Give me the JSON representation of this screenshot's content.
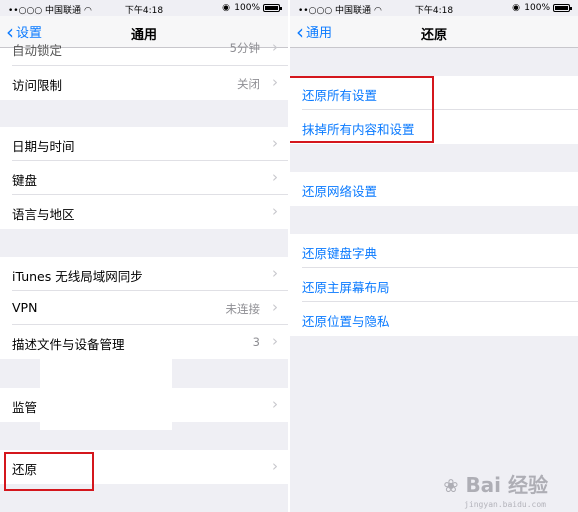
{
  "status": {
    "carrier": "••○○○ 中国联通",
    "time": "下午4:18",
    "battery": "100%"
  },
  "left": {
    "back_label": "设置",
    "title": "通用",
    "rows": {
      "auto_lock": {
        "label": "自动锁定",
        "value": "5分钟"
      },
      "restrictions": {
        "label": "访问限制",
        "value": "关闭"
      },
      "date_time": {
        "label": "日期与时间"
      },
      "keyboard": {
        "label": "键盘"
      },
      "language_region": {
        "label": "语言与地区"
      },
      "itunes_wifi_sync": {
        "label": "iTunes 无线局域网同步"
      },
      "vpn": {
        "label": "VPN",
        "value": "未连接"
      },
      "profiles": {
        "label": "描述文件与设备管理",
        "value": "3"
      },
      "supervision": {
        "label": "监管"
      },
      "reset": {
        "label": "还原"
      }
    }
  },
  "right": {
    "back_label": "通用",
    "title": "还原",
    "rows": {
      "reset_all_settings": {
        "label": "还原所有设置"
      },
      "erase_all": {
        "label": "抹掉所有内容和设置"
      },
      "reset_network": {
        "label": "还原网络设置"
      },
      "reset_keyboard_dictionary": {
        "label": "还原键盘字典"
      },
      "reset_home_layout": {
        "label": "还原主屏幕布局"
      },
      "reset_location_privacy": {
        "label": "还原位置与隐私"
      }
    }
  },
  "watermark": {
    "text": "Bai 经验",
    "sub": "jingyan.baidu.com"
  },
  "colors": {
    "accent": "#0a7aff",
    "highlight": "#d4161c",
    "background": "#efeff4"
  }
}
